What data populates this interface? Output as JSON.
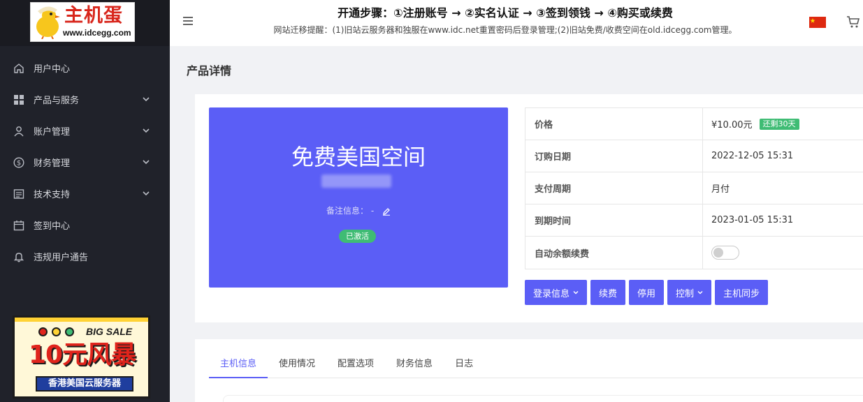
{
  "sidebar": {
    "logo": {
      "brand": "主机蛋",
      "url": "www.idcegg.com"
    },
    "items": [
      {
        "label": "用户中心",
        "icon": "home-icon",
        "expandable": false
      },
      {
        "label": "产品与服务",
        "icon": "grid-icon",
        "expandable": true
      },
      {
        "label": "账户管理",
        "icon": "user-icon",
        "expandable": true
      },
      {
        "label": "财务管理",
        "icon": "dollar-icon",
        "expandable": true
      },
      {
        "label": "技术支持",
        "icon": "ticket-icon",
        "expandable": true
      },
      {
        "label": "签到中心",
        "icon": "calendar-icon",
        "expandable": false
      },
      {
        "label": "违规用户通告",
        "icon": "bell-icon",
        "expandable": false
      }
    ],
    "promo": {
      "tag": "BIG SALE",
      "headline": "10元风暴",
      "sub": "香港美国云服务器"
    }
  },
  "header": {
    "title": "开通步骤：①注册账号 → ②实名认证 → ③签到领钱 → ④购买或续费",
    "notice": "网站迁移提醒：(1)旧站云服务器和独服在www.idc.net重置密码后登录管理;(2)旧站免费/收费空间在old.idcegg.com管理。",
    "flag_color": "#de2910"
  },
  "page": {
    "title": "产品详情"
  },
  "product": {
    "name": "免费美国空间",
    "note_label": "备注信息：",
    "note_value": "-",
    "status": "已激活"
  },
  "info": {
    "price_label": "价格",
    "price_value": "¥10.00元",
    "remain": "还剩30天",
    "order_date_label": "订购日期",
    "order_date_value": "2022-12-05 15:31",
    "cycle_label": "支付周期",
    "cycle_value": "月付",
    "expire_label": "到期时间",
    "expire_value": "2023-01-05 15:31",
    "auto_renew_label": "自动余额续费"
  },
  "actions": {
    "login_info": "登录信息",
    "renew": "续费",
    "disable": "停用",
    "control": "控制",
    "sync": "主机同步"
  },
  "tabs": [
    "主机信息",
    "使用情况",
    "配置选项",
    "财务信息",
    "日志"
  ],
  "colors": {
    "accent": "#5b5ef6",
    "success": "#3fbc74",
    "sidebar": "#20222a"
  }
}
